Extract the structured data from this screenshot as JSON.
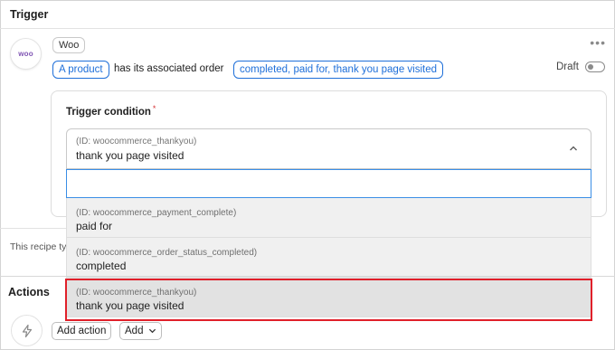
{
  "trigger": {
    "section_title": "Trigger",
    "integration_badge": "Woo",
    "logo_text": "woo",
    "sentence": {
      "token_left": "A product",
      "middle_text": "has its associated order",
      "token_right": "completed, paid for, thank you page visited"
    },
    "status_label": "Draft",
    "more_icon": "more-horizontal-icon"
  },
  "condition": {
    "title": "Trigger condition",
    "required_mark": "*",
    "selected": {
      "id_text": "(ID: woocommerce_thankyou)",
      "value": "thank you page visited"
    },
    "search": {
      "value": "",
      "placeholder": ""
    },
    "options": [
      {
        "id_text": "(ID: woocommerce_payment_complete)",
        "label": "paid for"
      },
      {
        "id_text": "(ID: woocommerce_order_status_completed)",
        "label": "completed"
      },
      {
        "id_text": "(ID: woocommerce_thankyou)",
        "label": "thank you page visited"
      }
    ],
    "highlight_color": "#e0202a"
  },
  "recipe_note": "This recipe ty",
  "actions": {
    "section_title": "Actions",
    "add_action_label": "Add action",
    "add_label": "Add"
  },
  "colors": {
    "accent": "#1e6fd9",
    "woo_purple": "#7f54b3"
  }
}
